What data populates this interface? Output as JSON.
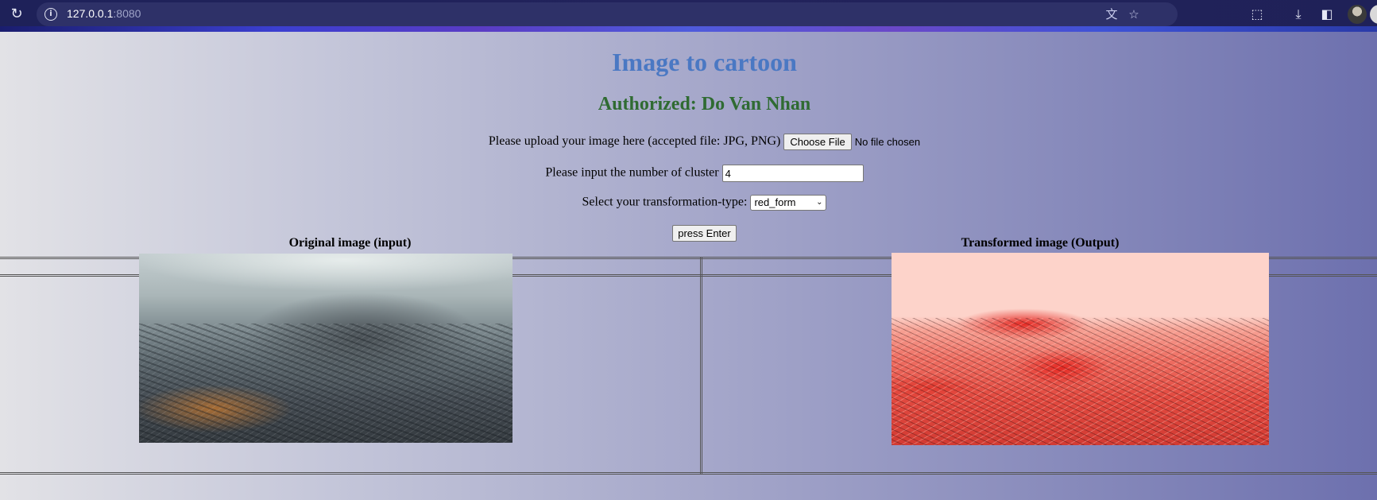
{
  "browser": {
    "url_host": "127.0.0.1",
    "url_port": ":8080"
  },
  "header": {
    "title": "Image to cartoon",
    "author": "Authorized: Do Van Nhan"
  },
  "form": {
    "upload_label": "Please upload your image here (accepted file: JPG, PNG)",
    "choose_file_label": "Choose File",
    "file_status": "No file chosen",
    "cluster_label": "Please input the number of cluster",
    "cluster_value": "4",
    "transform_label": "Select your transformation-type:",
    "transform_selected": "red_form",
    "submit_label": "press Enter"
  },
  "results": {
    "original_header": "Original image (input)",
    "transformed_header": "Transformed image (Output)"
  },
  "icons": {
    "reload": "reload-icon",
    "site_info": "info-icon",
    "translate": "translate-icon",
    "bookmark": "star-icon",
    "extensions": "puzzle-icon",
    "downloads": "download-icon",
    "side_panel": "side-panel-icon",
    "profile": "avatar"
  }
}
